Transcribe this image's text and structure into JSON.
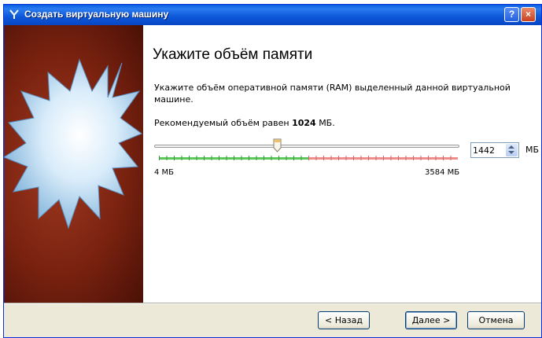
{
  "window": {
    "title": "Создать виртуальную машину",
    "help_button": "?",
    "close_button": "×"
  },
  "page": {
    "heading": "Укажите объём памяти",
    "description": "Укажите объём оперативной памяти (RAM) выделенный данной виртуальной машине.",
    "recommended_prefix": "Рекомендуемый объём равен",
    "recommended_value": "1024",
    "recommended_suffix": "МБ."
  },
  "memory": {
    "value": "1442",
    "unit": "МБ",
    "min_label": "4 МБ",
    "max_label": "3584 МБ",
    "slider_value_mb": 1442,
    "slider_min_mb": 4,
    "slider_max_mb": 3584,
    "recommended_range_fraction": 0.5,
    "colors": {
      "safe": "#5cc85c",
      "unsafe": "#f08c8c"
    }
  },
  "buttons": {
    "back": "< Назад",
    "next": "Далее >",
    "cancel": "Отмена"
  }
}
